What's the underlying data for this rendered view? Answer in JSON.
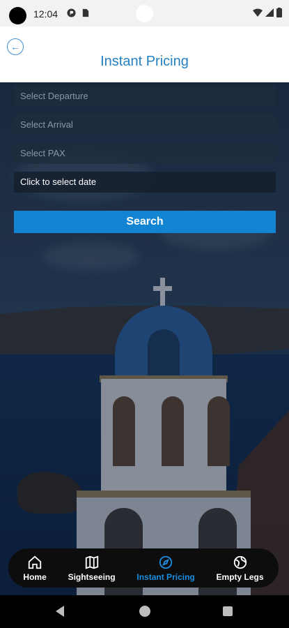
{
  "status_bar": {
    "time": "12:04"
  },
  "header": {
    "back_icon": "back-arrow-icon",
    "title": "Instant Pricing"
  },
  "form": {
    "departure_placeholder": "Select Departure",
    "arrival_placeholder": "Select Arrival",
    "pax_placeholder": "Select PAX",
    "date_label": "Click to select date",
    "search_label": "Search"
  },
  "bottom_nav": {
    "items": [
      {
        "label": "Home",
        "icon": "home-icon",
        "active": false
      },
      {
        "label": "Sightseeing",
        "icon": "map-icon",
        "active": false
      },
      {
        "label": "Instant Pricing",
        "icon": "compass-icon",
        "active": true
      },
      {
        "label": "Empty Legs",
        "icon": "globe-icon",
        "active": false
      }
    ]
  },
  "colors": {
    "accent": "#1284d2",
    "title": "#2680c2",
    "nav_bg": "#0d0d0d"
  }
}
